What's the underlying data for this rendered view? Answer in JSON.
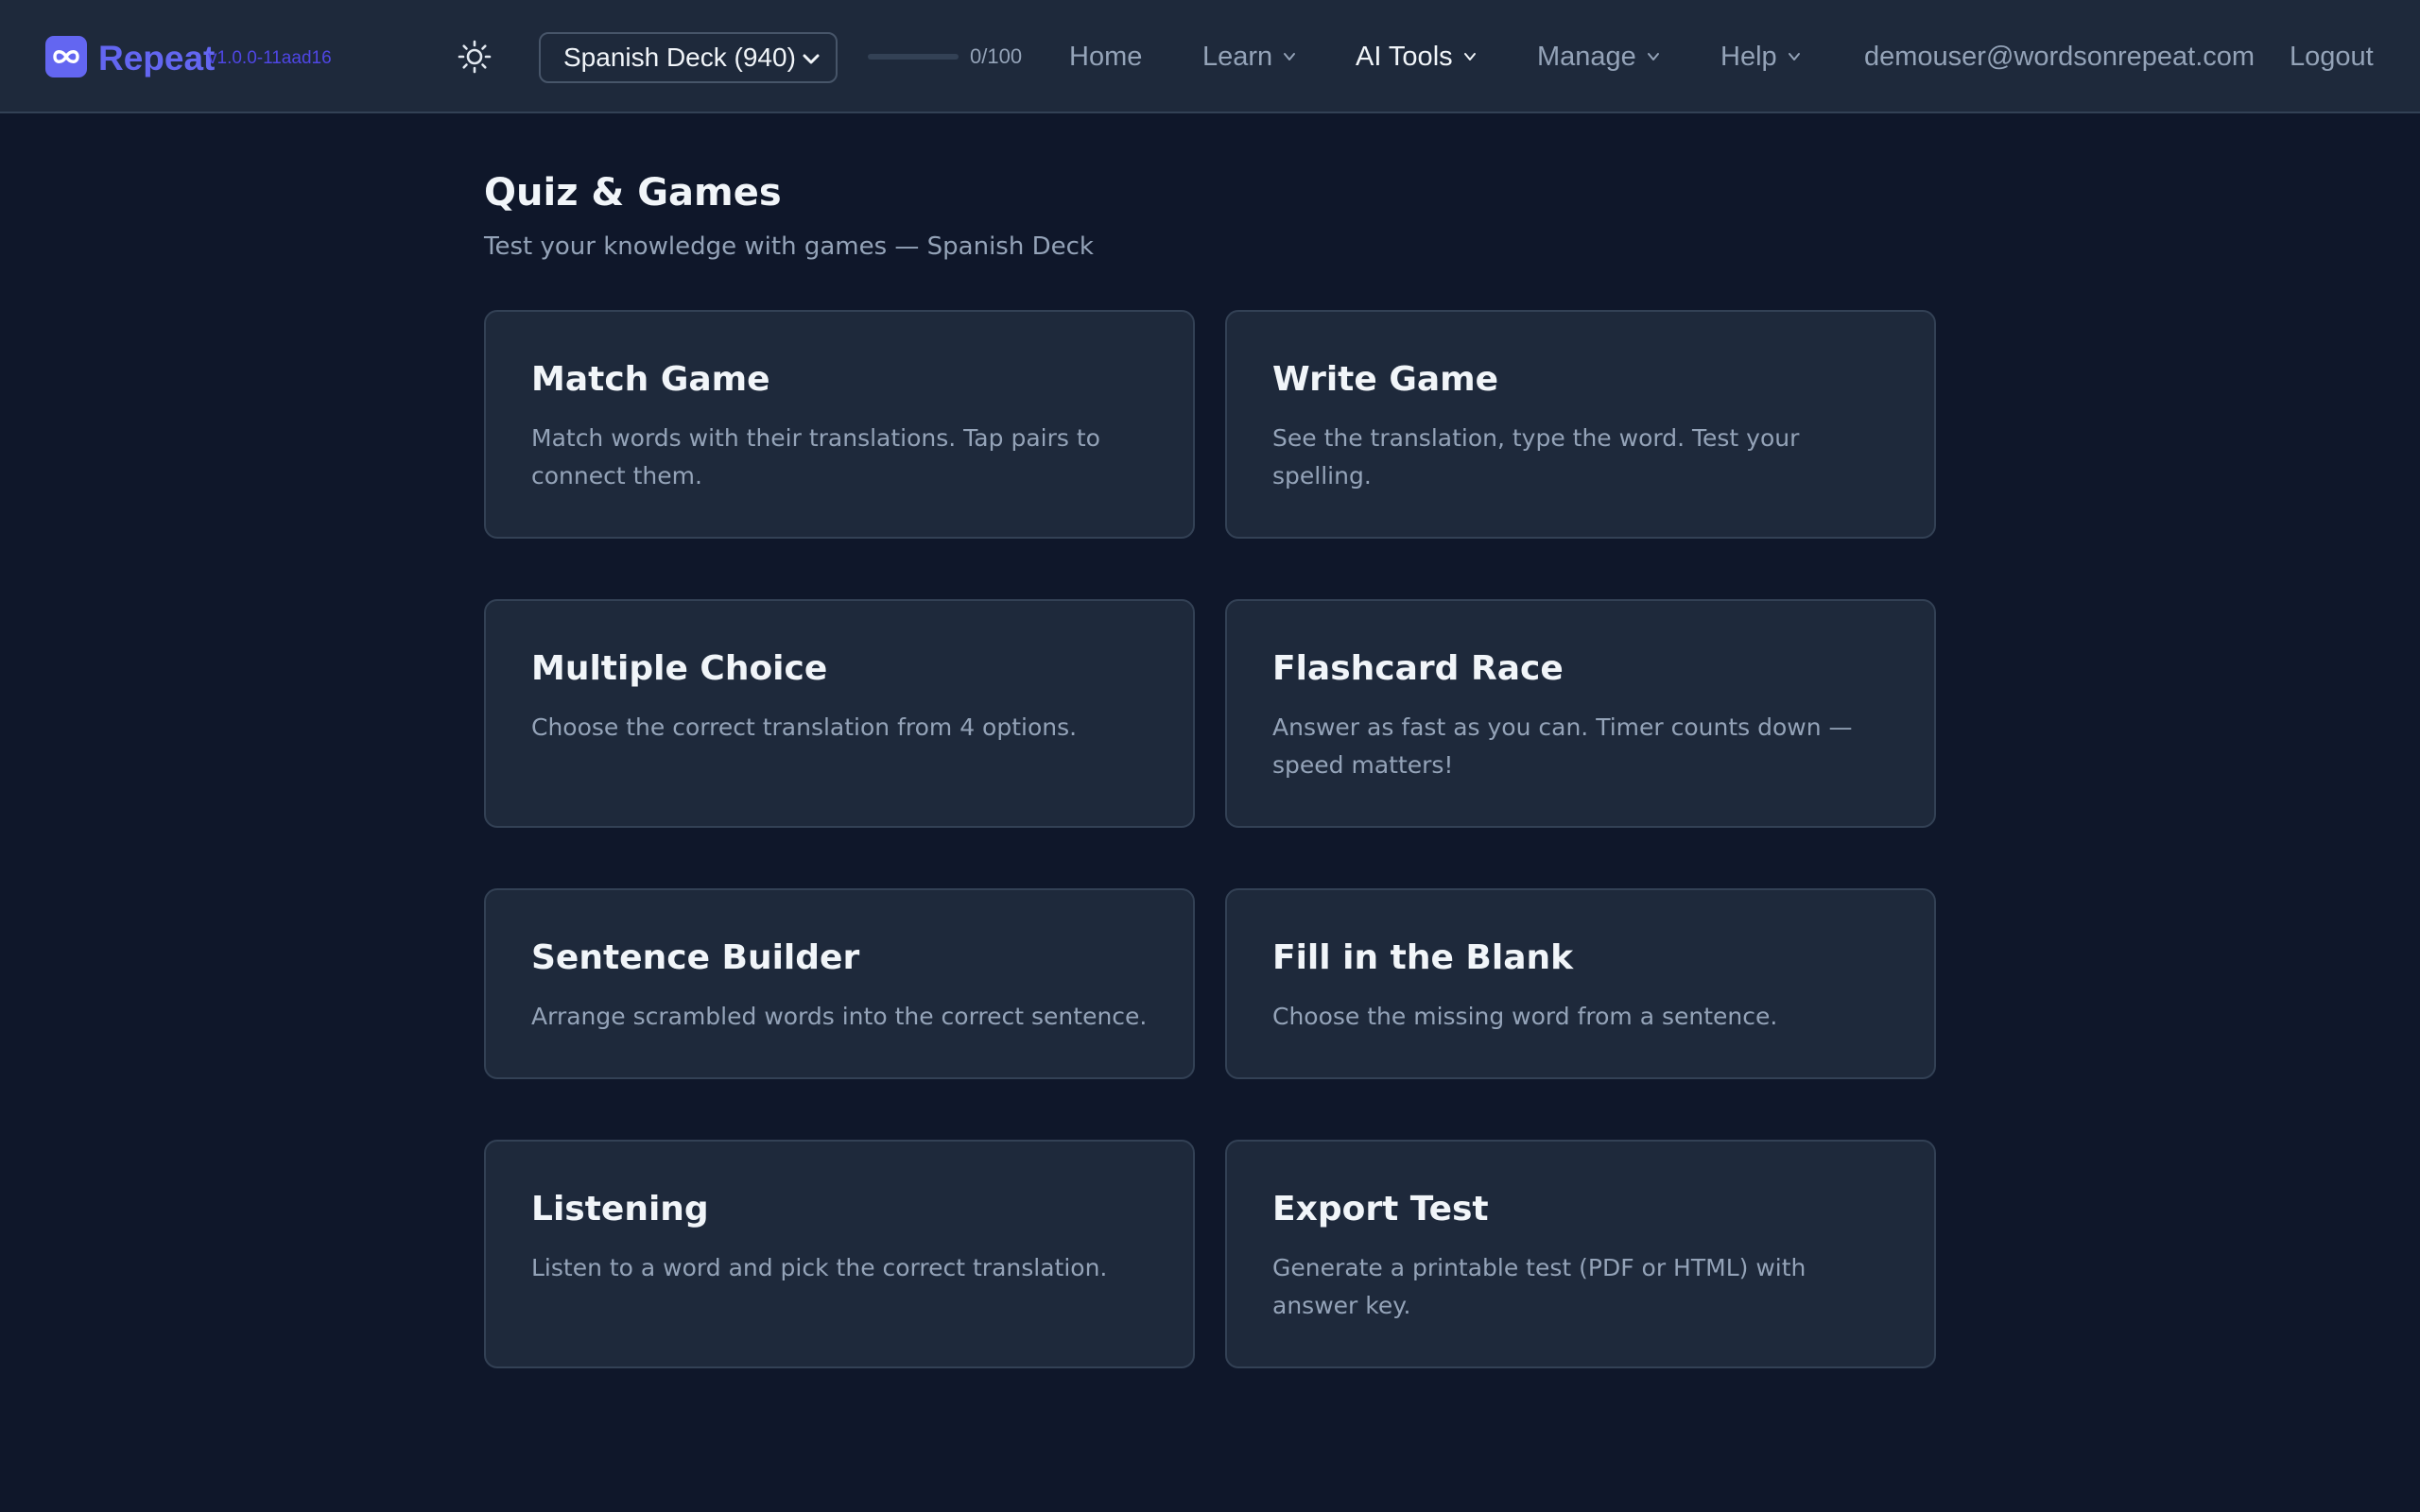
{
  "app": {
    "brand": "Repeat",
    "version": "v1.0.0-11aad16",
    "logo_icon": "infinity-icon",
    "theme_icon": "sun-icon",
    "accent_color": "#6366f1"
  },
  "header": {
    "deck_selector": {
      "selected": "Spanish Deck (940)"
    },
    "progress": {
      "label": "0/100",
      "value": 0,
      "max": 100
    },
    "nav": [
      {
        "label": "Home",
        "has_dropdown": false
      },
      {
        "label": "Learn",
        "has_dropdown": true
      },
      {
        "label": "AI Tools",
        "has_dropdown": true
      },
      {
        "label": "Manage",
        "has_dropdown": true
      },
      {
        "label": "Help",
        "has_dropdown": true
      }
    ],
    "user_email": "demouser@wordsonrepeat.com",
    "logout_label": "Logout"
  },
  "page": {
    "title": "Quiz & Games",
    "subtitle": "Test your knowledge with games — Spanish Deck"
  },
  "games": [
    {
      "title": "Match Game",
      "description": "Match words with their translations. Tap pairs to connect them."
    },
    {
      "title": "Write Game",
      "description": "See the translation, type the word. Test your spelling."
    },
    {
      "title": "Multiple Choice",
      "description": "Choose the correct translation from 4 options."
    },
    {
      "title": "Flashcard Race",
      "description": "Answer as fast as you can. Timer counts down — speed matters!"
    },
    {
      "title": "Sentence Builder",
      "description": "Arrange scrambled words into the correct sentence."
    },
    {
      "title": "Fill in the Blank",
      "description": "Choose the missing word from a sentence."
    },
    {
      "title": "Listening",
      "description": "Listen to a word and pick the correct translation."
    },
    {
      "title": "Export Test",
      "description": "Generate a printable test (PDF or HTML) with answer key."
    }
  ]
}
